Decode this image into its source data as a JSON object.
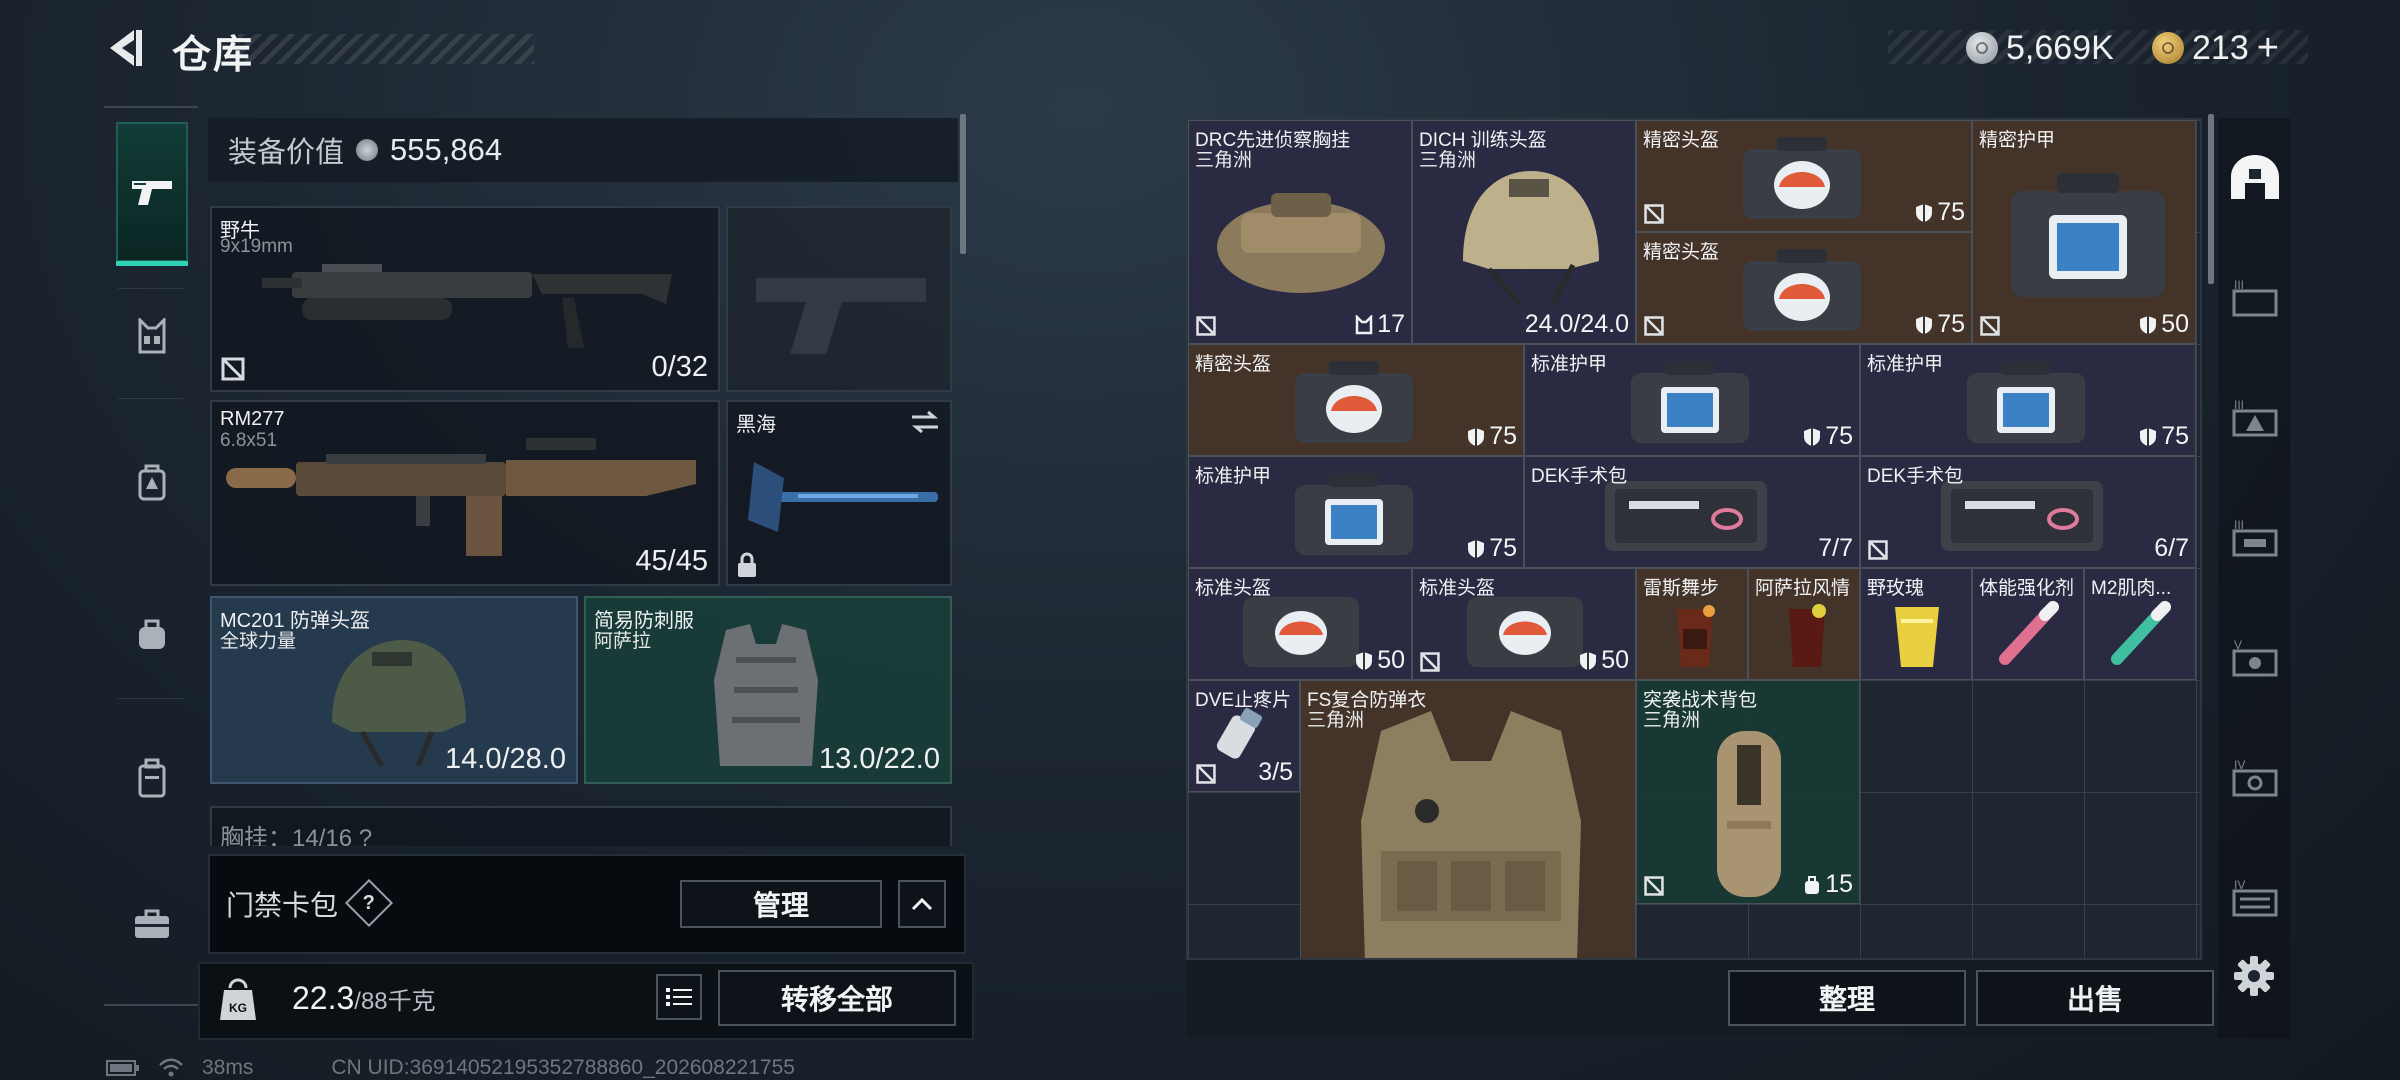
{
  "header": {
    "title": "仓库",
    "silver": "5,669K",
    "gold": "213",
    "gold_plus": "+"
  },
  "equipment_value": {
    "label": "装备价值",
    "value": "555,864"
  },
  "loadout": {
    "primary": {
      "name": "野牛",
      "caliber": "9x19mm",
      "ammo": "0/32"
    },
    "secondary": {
      "name": "RM277",
      "caliber": "6.8x51",
      "ammo": "45/45"
    },
    "melee": {
      "name": "黑海"
    },
    "helmet": {
      "name": "MC201 防弹头盔",
      "maker": "全球力量",
      "durability": "14.0/28.0"
    },
    "armor": {
      "name": "简易防刺服",
      "maker": "阿萨拉",
      "durability": "13.0/22.0"
    },
    "chest_partial": "胸挂：14/16  ?"
  },
  "access": {
    "label": "门禁卡包",
    "help": "?",
    "manage": "管理"
  },
  "bottom": {
    "weight": "22.3",
    "weight_max": "/88千克",
    "transfer": "转移全部",
    "kg": "KG"
  },
  "stash": {
    "items": [
      {
        "name": "DRC先进侦察胸挂",
        "maker": "三角洲",
        "count": "17"
      },
      {
        "name": "DICH 训练头盔",
        "maker": "三角洲",
        "count": "24.0/24.0"
      },
      {
        "name": "精密头盔",
        "count": "75"
      },
      {
        "name": "精密头盔",
        "count": "75"
      },
      {
        "name": "精密护甲",
        "count": "50"
      },
      {
        "name": "精密头盔",
        "count": "75"
      },
      {
        "name": "标准护甲",
        "count": "75"
      },
      {
        "name": "标准护甲",
        "count": "75"
      },
      {
        "name": "标准护甲",
        "count": "75"
      },
      {
        "name": "DEK手术包",
        "count": "7/7"
      },
      {
        "name": "DEK手术包",
        "count": "6/7"
      },
      {
        "name": "标准头盔",
        "count": "50"
      },
      {
        "name": "标准头盔",
        "count": "50"
      },
      {
        "name": "雷斯舞步"
      },
      {
        "name": "阿萨拉风情"
      },
      {
        "name": "野玫瑰"
      },
      {
        "name": "体能强化剂"
      },
      {
        "name": "M2肌肉..."
      },
      {
        "name": "DVE止疼片",
        "count": "3/5"
      },
      {
        "name": "FS复合防弹衣",
        "maker": "三角洲"
      },
      {
        "name": "突袭战术背包",
        "maker": "三角洲",
        "count": "15"
      }
    ],
    "sort": "整理",
    "sell": "出售"
  },
  "footer": {
    "ping": "38ms",
    "uid": "CN UID:36914052195352788860_202608221755"
  },
  "colors": {
    "accent": "#2fd3b3",
    "purple_bg": "#2b2b46",
    "brown_bg": "#463428",
    "green_bg": "#183a34"
  }
}
